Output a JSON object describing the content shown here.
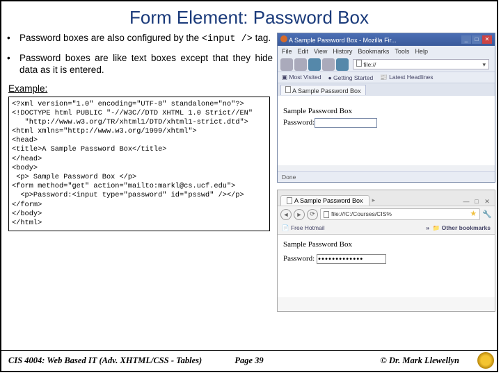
{
  "title": "Form Element: Password Box",
  "bullets": [
    {
      "pre": "Password boxes are also configured by the ",
      "code": "<input  />",
      "post": " tag."
    },
    {
      "text": "Password boxes are like text boxes except that they hide data as it is entered."
    }
  ],
  "example_label": "Example:",
  "code": "<?xml version=\"1.0\" encoding=\"UTF-8\" standalone=\"no\"?>\n<!DOCTYPE html PUBLIC \"-//W3C//DTD XHTML 1.0 Strict//EN\"\n   \"http://www.w3.org/TR/xhtml1/DTD/xhtml1-strict.dtd\">\n<html xmlns=\"http://www.w3.org/1999/xhtml\">\n<head>\n<title>A Sample Password Box</title>\n</head>\n<body>\n <p> Sample Password Box </p>\n<form method=\"get\" action=\"mailto:markl@cs.ucf.edu\">\n  <p>Password:<input type=\"password\" id=\"psswd\" /></p>\n</form>\n</body>\n</html>",
  "firefox": {
    "title": "A Sample Password Box - Mozilla Fir...",
    "menu": [
      "File",
      "Edit",
      "View",
      "History",
      "Bookmarks",
      "Tools",
      "Help"
    ],
    "address": "file://",
    "bookmarks": [
      "Most Visited",
      "Getting Started",
      "Latest Headlines"
    ],
    "tab": "A Sample Password Box",
    "page_heading": "Sample Password Box",
    "label": "Password:",
    "status": "Done"
  },
  "chrome": {
    "tab": "A Sample Password Box",
    "address": "file:///C:/Courses/CIS%",
    "bookmarks_left": "Free Hotmail",
    "bookmarks_right": "Other bookmarks",
    "page_heading": "Sample Password Box",
    "label": "Password:",
    "password_mask": "•••••••••••••"
  },
  "footer": {
    "course": "CIS 4004: Web Based IT (Adv. XHTML/CSS - Tables)",
    "page": "Page 39",
    "author": "© Dr. Mark Llewellyn"
  }
}
